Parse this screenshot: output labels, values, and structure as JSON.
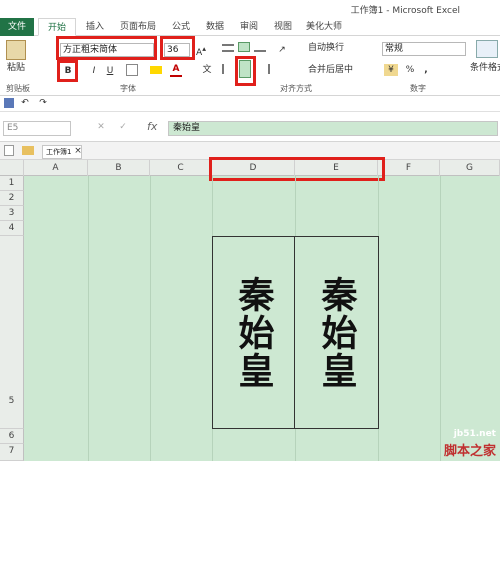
{
  "window": {
    "title": "工作簿1 - Microsoft Excel"
  },
  "tabs": [
    "文件",
    "开始",
    "插入",
    "页面布局",
    "公式",
    "数据",
    "审阅",
    "视图",
    "美化大师"
  ],
  "ribbon": {
    "paste": "粘贴",
    "font_name": "方正粗宋简体",
    "font_size": "36",
    "bold": "B",
    "italic": "I",
    "underline": "U",
    "wrap_text": "自动换行",
    "merge_center": "合并后居中",
    "number_format": "常规",
    "percent": "%",
    "comma": ",",
    "cond_format": "条件格式",
    "groups": {
      "clipboard": "剪贴板",
      "font": "字体",
      "alignment": "对齐方式",
      "number": "数字"
    }
  },
  "formula_bar": {
    "name_box": "E5",
    "fx": "fx",
    "content": "秦始皇"
  },
  "workbook_tab": "工作簿1",
  "columns": [
    "A",
    "B",
    "C",
    "D",
    "E",
    "F",
    "G"
  ],
  "rows": [
    "1",
    "2",
    "3",
    "4",
    "5",
    "6",
    "7"
  ],
  "cells": {
    "D5": "秦始皇",
    "E5": "秦始皇"
  },
  "watermark": {
    "url": "jb51.net",
    "text": "脚本之家"
  }
}
